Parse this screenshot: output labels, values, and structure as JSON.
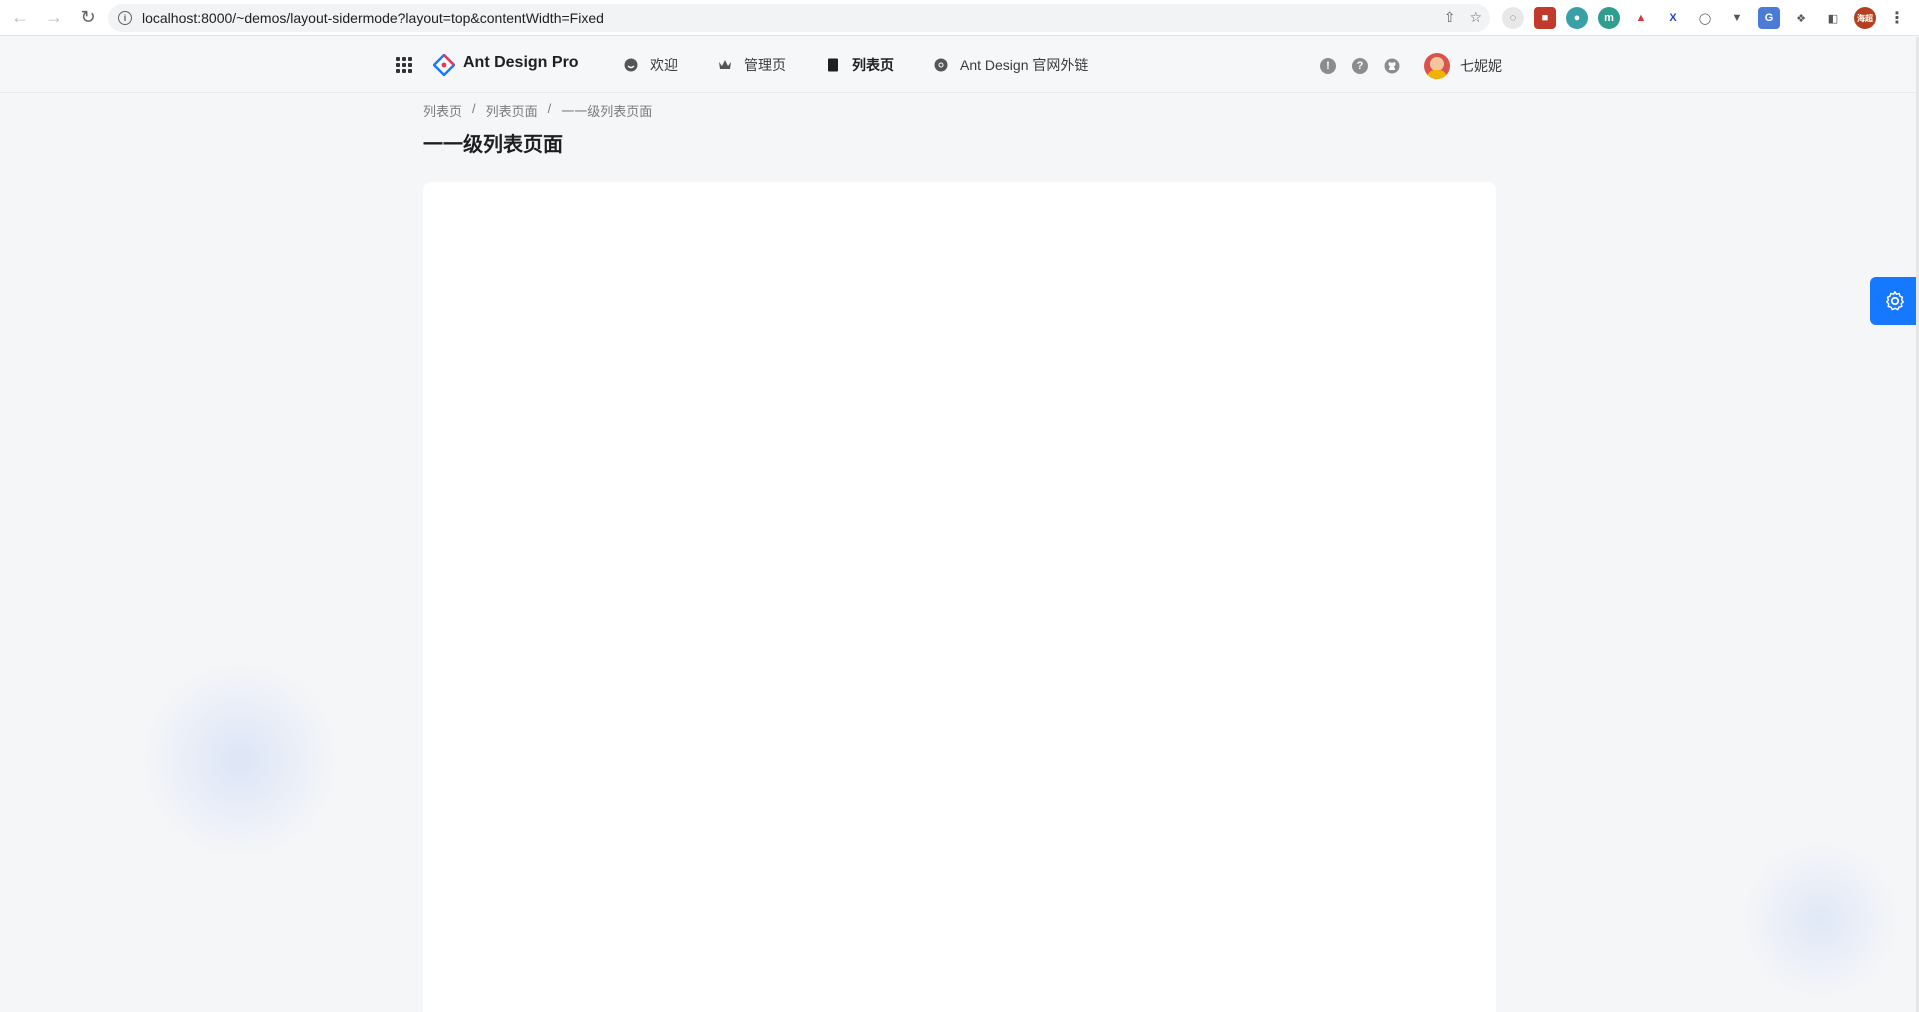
{
  "browser": {
    "url": "localhost:8000/~demos/layout-sidermode?layout=top&contentWidth=Fixed",
    "back_icon": "arrow-left-icon",
    "forward_icon": "arrow-right-icon",
    "reload_icon": "reload-icon",
    "profile_label": "海超"
  },
  "header": {
    "brand": "Ant Design Pro",
    "menu": [
      {
        "label": "欢迎",
        "icon": "smile-icon",
        "active": false
      },
      {
        "label": "管理页",
        "icon": "crown-icon",
        "active": false
      },
      {
        "label": "列表页",
        "icon": "table-icon",
        "active": true
      },
      {
        "label": "Ant Design 官网外链",
        "icon": "chrome-icon",
        "active": false
      }
    ],
    "actions": [
      "info-icon",
      "question-icon",
      "github-icon"
    ],
    "username": "七妮妮"
  },
  "breadcrumb": [
    "列表页",
    "列表页面",
    "一一级列表页面"
  ],
  "page": {
    "title": "一一级列表页面"
  },
  "colors": {
    "primary": "#1677ff",
    "background": "#f5f6f8"
  }
}
